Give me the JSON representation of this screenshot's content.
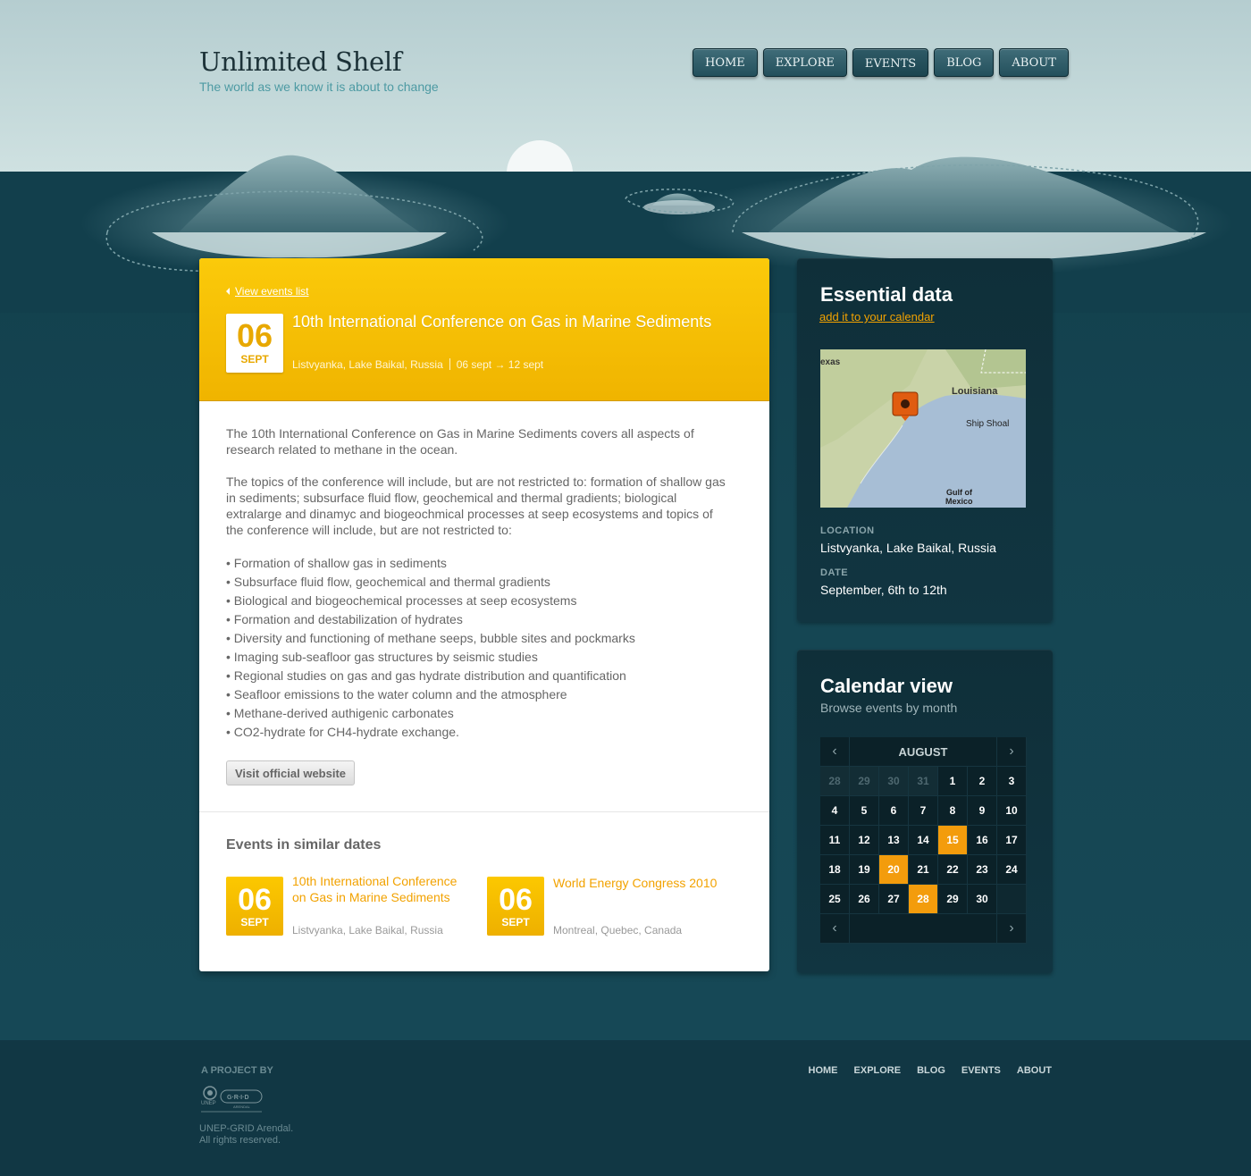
{
  "brand": {
    "title": "Unlimited Shelf",
    "tagline": "The world as we know it is about to change"
  },
  "nav": [
    {
      "label": "HOME"
    },
    {
      "label": "EXPLORE"
    },
    {
      "label": "EVENTS"
    },
    {
      "label": "BLOG"
    },
    {
      "label": "ABOUT"
    }
  ],
  "event": {
    "back_link": "View events list",
    "day": "06",
    "month": "SEPT",
    "title": "10th International Conference on Gas in Marine Sediments",
    "location": "Listvyanka, Lake Baikal, Russia",
    "dates": "06 sept → 12 sept",
    "intro": "The 10th International Conference on Gas in Marine Sediments covers all aspects of research related to methane in the ocean.",
    "topics_intro": "The topics of the conference will include, but are not restricted to: formation of shallow gas in sediments; subsurface fluid flow, geochemical and thermal gradients; biological extralarge and dinamyc and biogeochmical processes at seep ecosystems and topics of the conference will include, but are not restricted to:",
    "topics": [
      "Formation of shallow gas in sediments",
      "Subsurface fluid flow, geochemical and thermal gradients",
      "Biological and biogeochemical processes at seep ecosystems",
      "Formation and destabilization of hydrates",
      "Diversity and functioning of methane seeps, bubble sites and pockmarks",
      "Imaging sub-seafloor gas structures by seismic studies",
      "Regional studies on gas and gas hydrate distribution and quantification",
      "Seafloor emissions to the water column and the atmosphere",
      "Methane-derived authigenic carbonates",
      "CO2-hydrate for CH4-hydrate exchange."
    ],
    "visit_button": "Visit official website"
  },
  "similar": {
    "title": "Events in similar dates",
    "items": [
      {
        "day": "06",
        "month": "SEPT",
        "title": "10th International Conference on Gas in Marine Sediments",
        "location": "Listvyanka, Lake Baikal, Russia"
      },
      {
        "day": "06",
        "month": "SEPT",
        "title": "World Energy Congress 2010",
        "location": "Montreal, Quebec, Canada"
      }
    ]
  },
  "essential": {
    "title": "Essential data",
    "calendar_link": "add it to your calendar",
    "map_labels": {
      "texas": "exas",
      "louisiana": "Louisiana",
      "shoal": "Ship Shoal",
      "gulf1": "Gulf of",
      "gulf2": "Mexico"
    },
    "location_label": "LOCATION",
    "location": "Listvyanka, Lake Baikal, Russia",
    "date_label": "DATE",
    "date": "September, 6th to 12th"
  },
  "calendar": {
    "title": "Calendar view",
    "subtitle": "Browse events by month",
    "month": "AUGUST",
    "prev_icon": "chevron-left-icon",
    "next_icon": "chevron-right-icon",
    "weeks": [
      [
        "28",
        "29",
        "30",
        "31",
        "1",
        "2",
        "3"
      ],
      [
        "4",
        "5",
        "6",
        "7",
        "8",
        "9",
        "10"
      ],
      [
        "11",
        "12",
        "13",
        "14",
        "15",
        "16",
        "17"
      ],
      [
        "18",
        "19",
        "20",
        "21",
        "22",
        "23",
        "24"
      ],
      [
        "25",
        "26",
        "27",
        "28",
        "29",
        "30",
        ""
      ]
    ],
    "highlighted": [
      "15",
      "20",
      "28"
    ],
    "colors": {
      "highlight": "#f39c0c",
      "accent": "#f2a200"
    }
  },
  "footer": {
    "project_label": "A PROJECT BY",
    "copyright_line1": "UNEP-GRID Arendal.",
    "copyright_line2": "All rights reserved.",
    "logo_text": {
      "unep": "UNEP",
      "grid": "G·R·I·D",
      "arendal": "ARENDAL"
    },
    "nav": [
      {
        "label": "HOME"
      },
      {
        "label": "EXPLORE"
      },
      {
        "label": "BLOG"
      },
      {
        "label": "EVENTS"
      },
      {
        "label": "ABOUT"
      }
    ]
  }
}
